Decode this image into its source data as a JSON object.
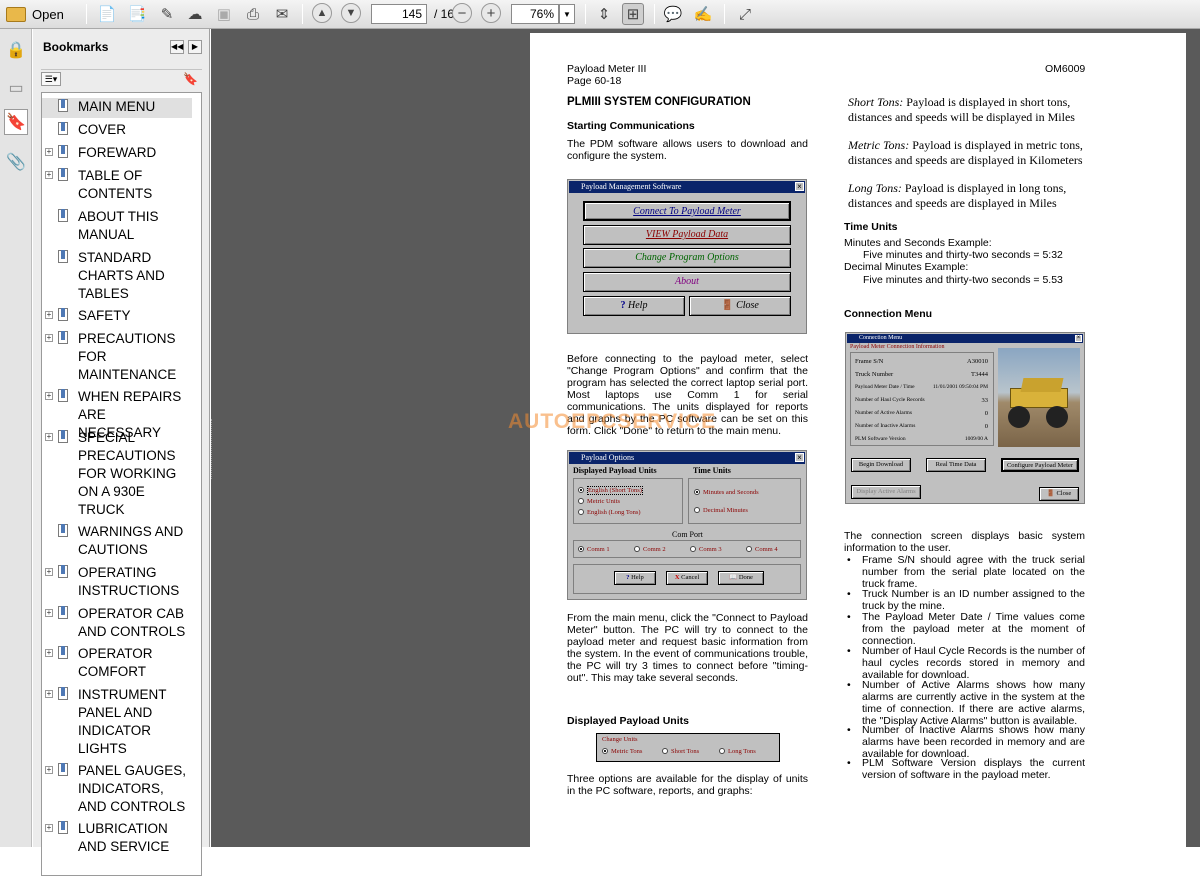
{
  "toolbar": {
    "open_label": "Open",
    "page_current": "145",
    "page_total": "/ 165",
    "zoom": "76%"
  },
  "bookmarks": {
    "title": "Bookmarks",
    "items": [
      {
        "label": "MAIN MENU",
        "expandable": false
      },
      {
        "label": "COVER",
        "expandable": false
      },
      {
        "label": "FOREWARD",
        "expandable": true
      },
      {
        "label": "TABLE OF CONTENTS",
        "expandable": true
      },
      {
        "label": "ABOUT THIS MANUAL",
        "expandable": false
      },
      {
        "label": "STANDARD CHARTS AND TABLES",
        "expandable": false
      },
      {
        "label": "SAFETY",
        "expandable": true
      },
      {
        "label": "PRECAUTIONS FOR MAINTENANCE",
        "expandable": true
      },
      {
        "label": "WHEN REPAIRS ARE NECESSARY",
        "expandable": true
      },
      {
        "label": "SPECIAL PRECAUTIONS FOR WORKING ON A 930E TRUCK",
        "expandable": true
      },
      {
        "label": "WARNINGS AND CAUTIONS",
        "expandable": false
      },
      {
        "label": "OPERATING INSTRUCTIONS",
        "expandable": true
      },
      {
        "label": "OPERATOR CAB AND CONTROLS",
        "expandable": true
      },
      {
        "label": "OPERATOR COMFORT",
        "expandable": true
      },
      {
        "label": "INSTRUMENT PANEL AND INDICATOR LIGHTS",
        "expandable": true
      },
      {
        "label": "PANEL GAUGES, INDICATORS, AND CONTROLS",
        "expandable": true
      },
      {
        "label": "LUBRICATION AND SERVICE",
        "expandable": true
      }
    ]
  },
  "doc": {
    "header_left_1": "Payload Meter III",
    "header_left_2": "Page 60-18",
    "header_right": "OM6009",
    "section_title": "PLMIII SYSTEM CONFIGURATION",
    "sub_starting": "Starting Communications",
    "p_starting": "The PDM software allows users to download and configure the system.",
    "p_before": "Before connecting to the payload meter, select \"Change Program Options\" and confirm that the program has selected the correct laptop serial port. Most laptops use Comm 1 for serial communications. The units displayed for reports and graphs by the PC software can be set on this form. Click \"Done\" to return to the main menu.",
    "p_main": "From the main menu, click the \"Connect to Payload Meter\" button. The PC will try to connect to the payload meter and request basic information from the system. In the event of communications trouble, the PC will try 3 times to connect before \"timing-out\". This may take several seconds.",
    "sub_displayed": "Displayed Payload Units",
    "p_three": "Three options are available for the display of units in the PC software, reports, and graphs:",
    "short_tons_term": "Short Tons:",
    "short_tons_text": "Payload is displayed in short tons, distances and speeds will be displayed in Miles",
    "metric_tons_term": "Metric Tons:",
    "metric_tons_text": "Payload is displayed in metric tons, distances and speeds are displayed in Kilometers",
    "long_tons_term": "Long Tons:",
    "long_tons_text": "Payload is displayed in long tons, distances and speeds are displayed in Miles",
    "sub_time": "Time Units",
    "time_1": "Minutes and Seconds Example:",
    "time_2": "Five minutes and thirty-two seconds = 5:32",
    "time_3": "Decimal Minutes Example:",
    "time_4": "Five minutes and thirty-two seconds = 5.53",
    "sub_connection": "Connection Menu",
    "p_connection": "The connection screen displays basic system information to the user.",
    "bullets": [
      "Frame S/N should agree with the truck serial number from the serial plate located on the truck frame.",
      "Truck Number is an ID number assigned to the truck by the mine.",
      "The Payload Meter Date / Time values come from the payload meter at the moment of connection.",
      "Number of Haul Cycle Records is the number of haul cycles records stored in memory and available for download.",
      "Number of Active Alarms shows how many alarms are currently active in the system at the time of connection. If there are active alarms, the \"Display Active Alarms\" button is available.",
      "Number of Inactive Alarms shows how many alarms have been recorded in memory and are available for download.",
      "PLM Software Version displays the current version of software in the payload meter."
    ]
  },
  "pms_window": {
    "title": "Payload Management Software",
    "btn_connect": "Connect To Payload Meter",
    "btn_view": "VIEW Payload Data",
    "btn_change": "Change Program Options",
    "btn_about": "About",
    "btn_help": "Help",
    "btn_close": "Close"
  },
  "options_window": {
    "title": "Payload Options",
    "units_header": "Displayed Payload Units",
    "time_header": "Time Units",
    "opt_english_short": "English (Short Tons)",
    "opt_metric": "Metric Units",
    "opt_english_long": "English (Long Tons)",
    "opt_minsec": "Minutes and Seconds",
    "opt_decimal": "Decimal Minutes",
    "com_header": "Com Port",
    "com1": "Comm 1",
    "com2": "Comm 2",
    "com3": "Comm 3",
    "com4": "Comm 4",
    "btn_help": "Help",
    "btn_cancel": "Cancel",
    "btn_done": "Done"
  },
  "conn_window": {
    "title": "Connection Menu",
    "group": "Payload Meter Connection Information",
    "rows": [
      {
        "label": "Frame S/N",
        "value": "A30010"
      },
      {
        "label": "Truck Number",
        "value": "T3444"
      },
      {
        "label": "Payload Meter Date / Time",
        "value": "11/01/2001 09:50:04 PM"
      },
      {
        "label": "Number of Haul Cycle Records",
        "value": "33"
      },
      {
        "label": "Number of Active Alarms",
        "value": "0"
      },
      {
        "label": "Number of Inactive Alarms",
        "value": "0"
      },
      {
        "label": "PLM Software Version",
        "value": "1009/00 A"
      }
    ],
    "btn_download": "Begin Download",
    "btn_realtime": "Real Time Data",
    "btn_configure": "Configure Payload Meter",
    "btn_alarms": "Display Active Alarms",
    "btn_close": "Close"
  },
  "units_box": {
    "group": "Change Units",
    "metric": "Metric Tons",
    "short": "Short Tons",
    "long": "Long Tons"
  },
  "watermark": "AUTOEPCSERVICE"
}
